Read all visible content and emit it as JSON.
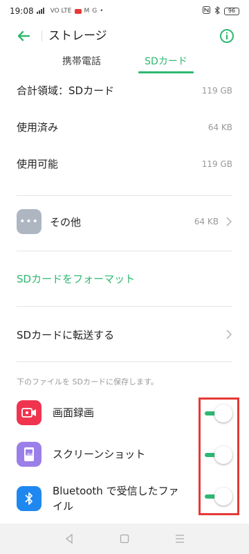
{
  "status_bar": {
    "time": "19:08",
    "signal_text": "VO LTE",
    "gmail_glyph": "M",
    "g_glyph": "G",
    "battery": "96"
  },
  "app_bar": {
    "title": "ストレージ"
  },
  "tabs": {
    "phone": "携帯電話",
    "sd": "SDカード",
    "selected": "sd"
  },
  "summary": {
    "total_label": "合計領域：SDカード",
    "total_value": "119 GB",
    "used_label": "使用済み",
    "used_value": "64 KB",
    "available_label": "使用可能",
    "available_value": "119 GB"
  },
  "other": {
    "label": "その他",
    "size": "64 KB"
  },
  "format_link": "SDカードをフォーマット",
  "transfer_label": "SDカードに転送する",
  "save_note": "下のファイルを SDカードに保存します。",
  "apps": [
    {
      "label": "画面録画",
      "icon": "screen-record-icon",
      "color": "#f0344f",
      "enabled": true
    },
    {
      "label": "スクリーンショット",
      "icon": "screenshot-icon",
      "color": "#9b7fe8",
      "enabled": true
    },
    {
      "label": "Bluetooth で受信したファイル",
      "icon": "bluetooth-icon",
      "color": "#1e88f0",
      "enabled": true
    }
  ],
  "colors": {
    "accent": "#2eb871",
    "highlight": "#e53935"
  }
}
